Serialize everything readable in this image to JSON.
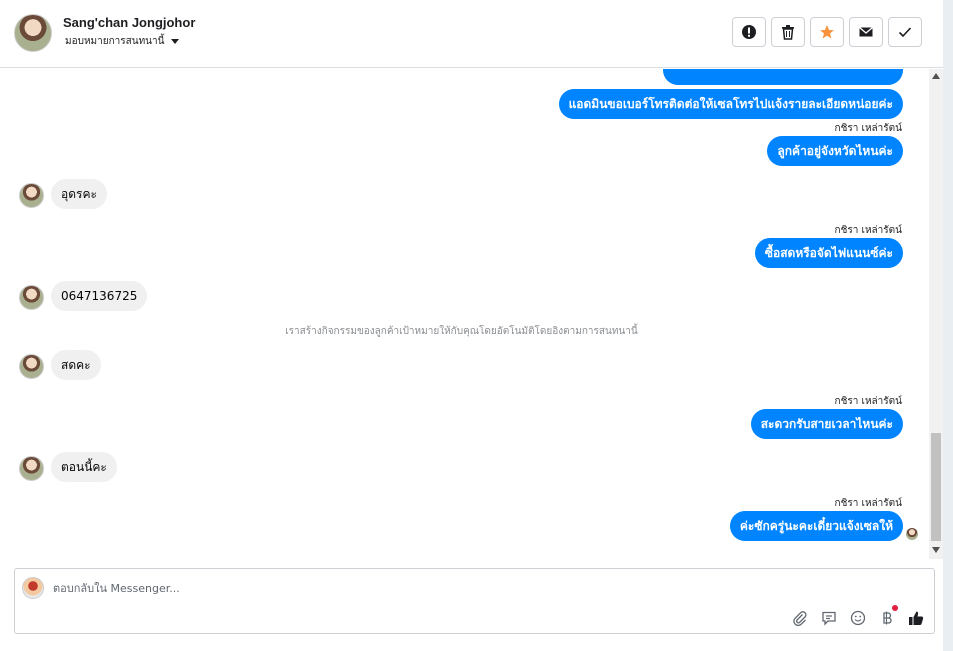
{
  "header": {
    "contact_name": "Sang'chan Jongjohor",
    "assign_label": "มอบหมายการสนทนานี้",
    "actions": [
      {
        "name": "report-icon",
        "label": "!"
      },
      {
        "name": "trash-icon",
        "label": "delete"
      },
      {
        "name": "star-icon",
        "label": "star"
      },
      {
        "name": "mail-icon",
        "label": "mark unread"
      },
      {
        "name": "check-icon",
        "label": "done"
      }
    ]
  },
  "messages": {
    "m1_out": "แอดมินขอเบอร์โทรติดต่อให้เซลโทรไปแจ้งรายละเอียดหน่อยค่ะ",
    "sender1": "กชิรา เหล่ารัตน์",
    "m2_out": "ลูกค้าอยู่จังหวัดไหนค่ะ",
    "m3_in": "อุดรคะ",
    "sender2": "กชิรา เหล่ารัตน์",
    "m4_out": "ซื้อสดหรือจัดไฟแนนซ์ค่ะ",
    "m5_in": "0647136725",
    "system": "เราสร้างกิจกรรมของลูกค้าเป้าหมายให้กับคุณโดยอัตโนมัติโดยอิงตามการสนทนานี้",
    "m6_in": "สดคะ",
    "sender3": "กชิรา เหล่ารัตน์",
    "m7_out": "สะดวกรับสายเวลาไหนค่ะ",
    "m8_in": "ตอนนี้คะ",
    "sender4": "กชิรา เหล่ารัตน์",
    "m9_out": "ค่ะซักครู่นะคะเดี๋ยวแจ้งเซลให้"
  },
  "composer": {
    "placeholder": "ตอบกลับใน Messenger..."
  },
  "colors": {
    "accent": "#0084ff",
    "star": "#f7923b",
    "like": "#1c1e21"
  }
}
